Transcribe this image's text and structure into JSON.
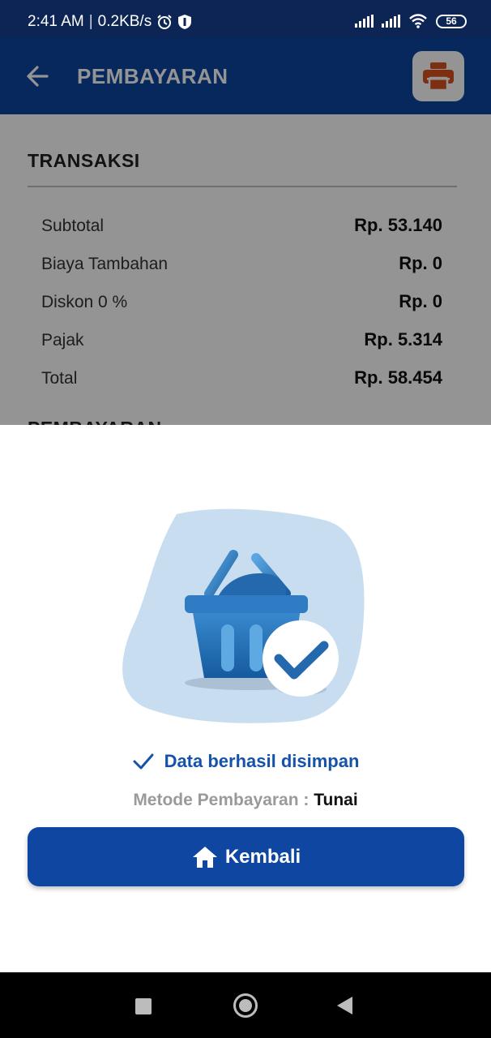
{
  "status_bar": {
    "time": "2:41 AM",
    "network_speed": "0.2KB/s",
    "battery": "56",
    "icons": [
      "alarm-icon",
      "shield-icon",
      "signal-icon",
      "signal-icon",
      "wifi-icon",
      "battery-icon"
    ]
  },
  "app_bar": {
    "title": "PEMBAYARAN",
    "back_icon": "arrow-left-icon",
    "print_icon": "printer-icon"
  },
  "transaction": {
    "section_title": "TRANSAKSI",
    "rows": [
      {
        "label": "Subtotal",
        "value": "Rp. 53.140"
      },
      {
        "label": "Biaya Tambahan",
        "value": "Rp. 0"
      },
      {
        "label": "Diskon 0 %",
        "value": "Rp. 0"
      },
      {
        "label": "Pajak",
        "value": "Rp. 5.314"
      },
      {
        "label": "Total",
        "value": "Rp. 58.454"
      }
    ],
    "next_section_title": "PEMBAYARAN"
  },
  "sheet": {
    "success_message": "Data berhasil disimpan",
    "method_label": "Metode Pembayaran : ",
    "method_value": "Tunai",
    "home_button_label": "Kembali",
    "home_icon": "home-icon",
    "illustration_icon": "basket-check-icon"
  },
  "colors": {
    "primary": "#0d45a0",
    "status_bar": "#0c2554",
    "accent_print": "#d9521f",
    "success_text": "#1553ab"
  }
}
